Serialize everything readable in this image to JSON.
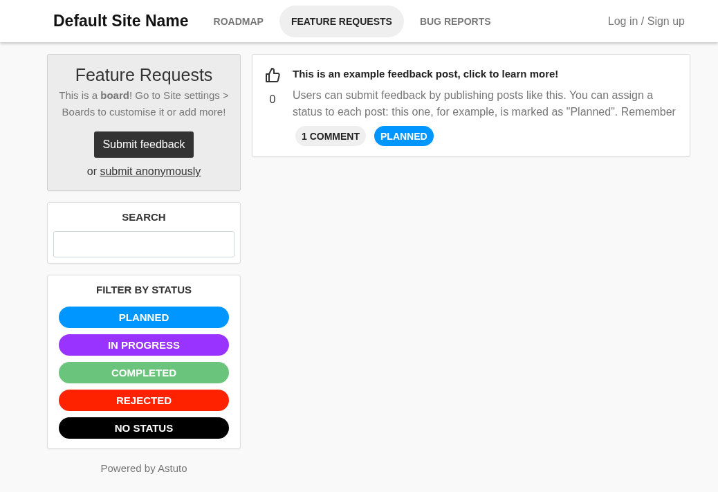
{
  "header": {
    "site_name": "Default Site Name",
    "tabs": [
      {
        "label": "ROADMAP",
        "selected": false
      },
      {
        "label": "FEATURE REQUESTS",
        "selected": true
      },
      {
        "label": "BUG REPORTS",
        "selected": false
      }
    ],
    "login_link": "Log in / Sign up"
  },
  "board": {
    "title": "Feature Requests",
    "description": "This is a **board**! Go to Site settings > Boards to customise it or add more!",
    "submit_button": "Submit feedback",
    "anonymous_prefix": "or",
    "anonymous_link": "submit anonymously"
  },
  "search": {
    "title": "SEARCH"
  },
  "status_filter": {
    "title": "FILTER BY STATUS",
    "statuses": [
      {
        "label": "PLANNED",
        "color": "#0096ff"
      },
      {
        "label": "IN PROGRESS",
        "color": "#9933ff"
      },
      {
        "label": "COMPLETED",
        "color": "#6ac47c"
      },
      {
        "label": "REJECTED",
        "color": "#ff2200"
      },
      {
        "label": "NO STATUS",
        "color": "#000000"
      }
    ]
  },
  "footer": "Powered by Astuto",
  "posts": [
    {
      "title": "This is an example feedback post, click to learn more!",
      "votes": "0",
      "description": "Users can submit feedback by publishing posts like this. You can assign a status to each post: this one, for example, is marked as \"Planned\". Remember",
      "comments": "1 COMMENT",
      "status": {
        "label": "PLANNED",
        "color": "#0096ff"
      }
    }
  ]
}
